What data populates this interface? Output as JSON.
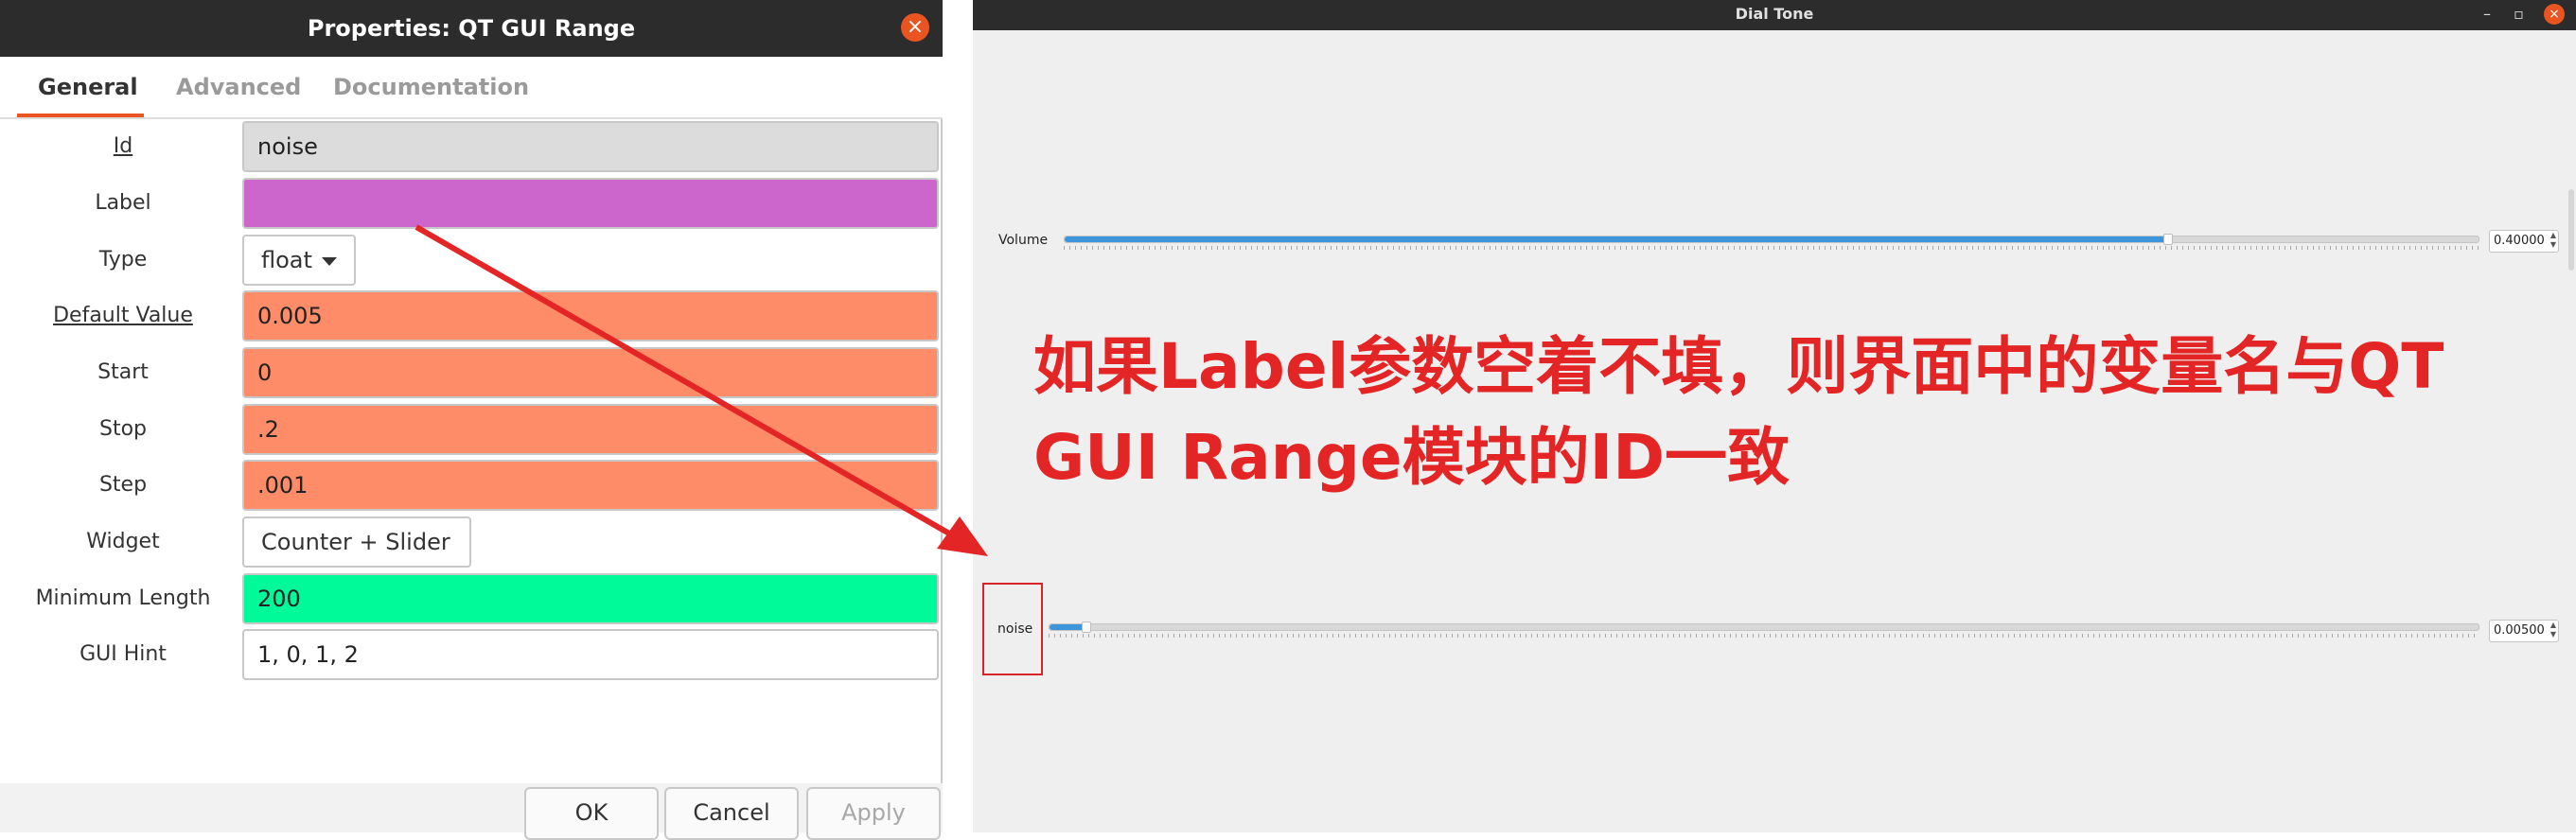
{
  "dialog": {
    "title": "Properties: QT GUI Range",
    "tabs": [
      {
        "label": "General",
        "active": true
      },
      {
        "label": "Advanced",
        "active": false
      },
      {
        "label": "Documentation",
        "active": false
      }
    ],
    "rows": [
      {
        "label": "Id",
        "value": "noise",
        "kind": "text",
        "color": "#dcdcdc"
      },
      {
        "label": "Label",
        "value": "",
        "kind": "text",
        "color": "#cc66cc"
      },
      {
        "label": "Type",
        "value": "float",
        "kind": "combo"
      },
      {
        "label": "Default Value",
        "value": "0.005",
        "kind": "text",
        "color": "#ff8c69"
      },
      {
        "label": "Start",
        "value": "0",
        "kind": "text",
        "color": "#ff8c69"
      },
      {
        "label": "Stop",
        "value": ".2",
        "kind": "text",
        "color": "#ff8c69"
      },
      {
        "label": "Step",
        "value": ".001",
        "kind": "text",
        "color": "#ff8c69"
      },
      {
        "label": "Widget",
        "value": "Counter + Slider",
        "kind": "combo"
      },
      {
        "label": "Minimum Length",
        "value": "200",
        "kind": "text",
        "color": "#00fa9a"
      },
      {
        "label": "GUI Hint",
        "value": "1, 0, 1, 2",
        "kind": "text",
        "color": "#ffffff"
      }
    ],
    "buttons": {
      "ok": "OK",
      "cancel": "Cancel",
      "apply": "Apply"
    }
  },
  "app": {
    "title": "Dial Tone",
    "window_controls": {
      "minimize": "–",
      "restore": "▫",
      "close": "×"
    },
    "controls": [
      {
        "label": "Volume",
        "value": "0.40000",
        "fraction": 0.78
      },
      {
        "label": "noise",
        "value": "0.00500",
        "fraction": 0.025
      }
    ]
  },
  "annotation": {
    "text": "如果Label参数空着不填，则界面中的变量名与QT GUI Range模块的ID一致",
    "color": "#e32526"
  },
  "accent_color": "#e95420"
}
